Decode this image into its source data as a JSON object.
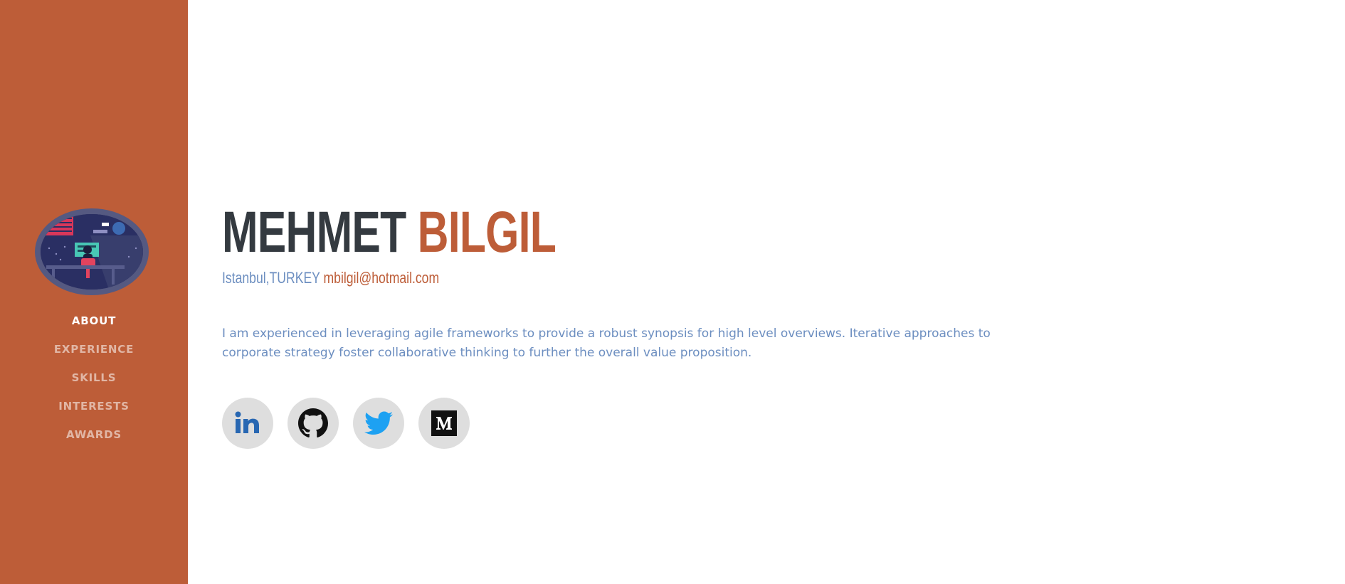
{
  "sidebar": {
    "avatar_alt": "profile picture",
    "nav": [
      {
        "label": "ABOUT",
        "active": true
      },
      {
        "label": "EXPERIENCE",
        "active": false
      },
      {
        "label": "SKILLS",
        "active": false
      },
      {
        "label": "INTERESTS",
        "active": false
      },
      {
        "label": "AWARDS",
        "active": false
      }
    ]
  },
  "about": {
    "first_name": "MEHMET",
    "last_name": "BILGIL",
    "location": "Istanbul,TURKEY",
    "email": "mbilgil@hotmail.com",
    "bio": "I am experienced in leveraging agile frameworks to provide a robust synopsis for high level overviews. Iterative approaches to corporate strategy foster collaborative thinking to further the overall value proposition."
  },
  "social": [
    {
      "icon": "linkedin-icon",
      "color": "#2867b2"
    },
    {
      "icon": "github-icon",
      "color": "#111111"
    },
    {
      "icon": "twitter-icon",
      "color": "#1da1f2"
    },
    {
      "icon": "medium-icon",
      "color": "#111111"
    }
  ],
  "colors": {
    "accent": "#bd5d38",
    "dark": "#343a40",
    "muted_blue": "#6c8ec0",
    "icon_bg": "#dedede"
  }
}
